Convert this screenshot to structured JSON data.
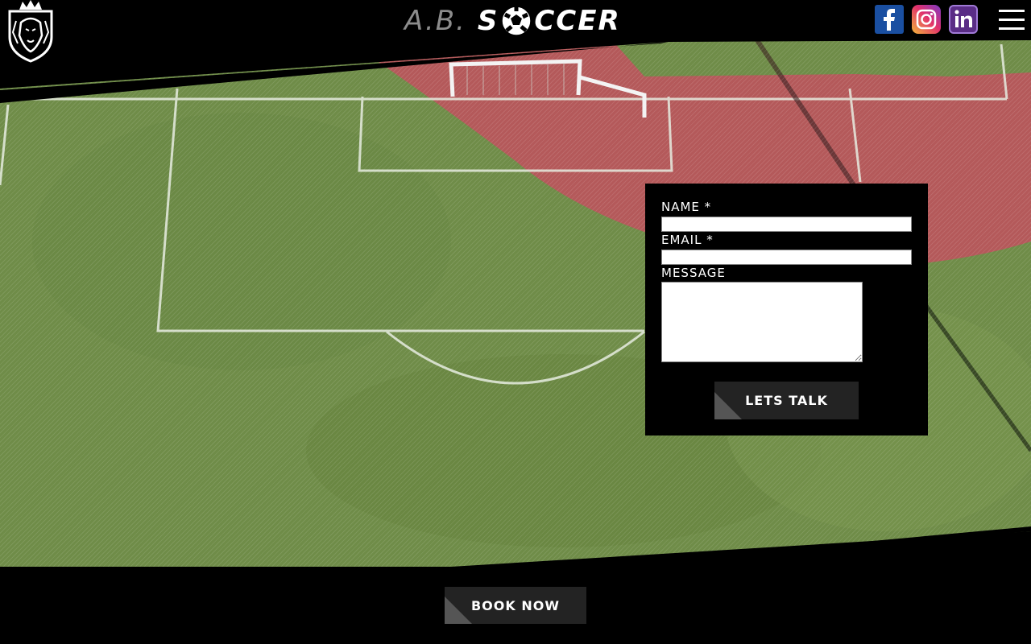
{
  "header": {
    "brand_prefix": "A.B.",
    "brand_s": "S",
    "brand_rest": "CCER",
    "logo_icon": "lion-crest-icon",
    "social": [
      "facebook-icon",
      "instagram-icon",
      "linkedin-icon"
    ],
    "menu_icon": "hamburger-menu-icon"
  },
  "contact_form": {
    "name_label": "NAME *",
    "email_label": "EMAIL *",
    "message_label": "MESSAGE",
    "name_value": "",
    "email_value": "",
    "message_value": "",
    "submit_label": "LETS TALK"
  },
  "footer": {
    "book_label": "BOOK NOW"
  },
  "colors": {
    "background": "#000000",
    "button": "#232323",
    "field_green": "#6f8c48",
    "track_red": "#b4595a"
  }
}
